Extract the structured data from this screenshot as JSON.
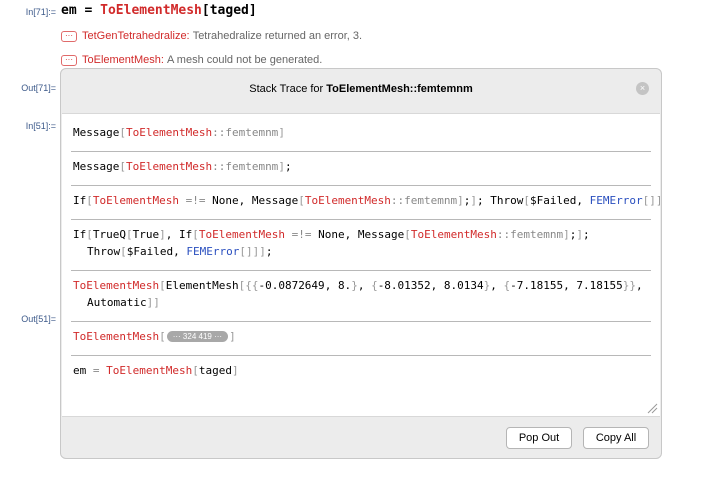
{
  "cells": {
    "in71": "In[71]:=",
    "out71": "Out[71]=",
    "in51": "In[51]:=",
    "out51": "Out[51]="
  },
  "input_line": {
    "var": "em",
    "eq": " = ",
    "func": "ToElementMesh",
    "arg": "taged"
  },
  "messages": [
    {
      "icon": "···",
      "name": "TetGenTetrahedralize:",
      "text": "Tetrahedralize returned an error, 3."
    },
    {
      "icon": "···",
      "name": "ToElementMesh:",
      "text": "A mesh could not be generated."
    }
  ],
  "dialog": {
    "title_prefix": "Stack Trace for ",
    "title_bold": "ToElementMesh::femtemnm",
    "close_icon": "×",
    "pop_out": "Pop Out",
    "copy_all": "Copy All"
  },
  "trace": {
    "r1_msg": "Message",
    "r1_head": "ToElementMesh",
    "r1_tag": "femtemnm",
    "r2_msg": "Message",
    "r2_head": "ToElementMesh",
    "r2_tag": "femtemnm",
    "r3_if": "If",
    "r3_head": "ToElementMesh",
    "r3_op": "=!=",
    "r3_none": "None",
    "r3_msg": "Message",
    "r3_head2": "ToElementMesh",
    "r3_tag": "femtemnm",
    "r3_throw": "Throw",
    "r3_failed": "$Failed",
    "r3_fem": "FEMError",
    "r4_if": "If",
    "r4_trueq": "TrueQ",
    "r4_true": "True",
    "r4_if2": "If",
    "r4_head": "ToElementMesh",
    "r4_op": "=!=",
    "r4_none": "None",
    "r4_msg": "Message",
    "r4_head2": "ToElementMesh",
    "r4_tag": "femtemnm",
    "r4b_throw": "Throw",
    "r4b_failed": "$Failed",
    "r4b_fem": "FEMError",
    "r5_head": "ToElementMesh",
    "r5_em": "ElementMesh",
    "r5_n1": "-0.0872649",
    "r5_n2": "8.",
    "r5_n3": "-8.01352",
    "r5_n4": "8.0134",
    "r5_n5": "-7.18155",
    "r5_n6": "7.18155",
    "r5b_auto": "Automatic",
    "r6_head": "ToElementMesh",
    "r6_count": "··· 324 419 ···",
    "r7_var": "em",
    "r7_eq": "=",
    "r7_head": "ToElementMesh",
    "r7_arg": "taged"
  }
}
